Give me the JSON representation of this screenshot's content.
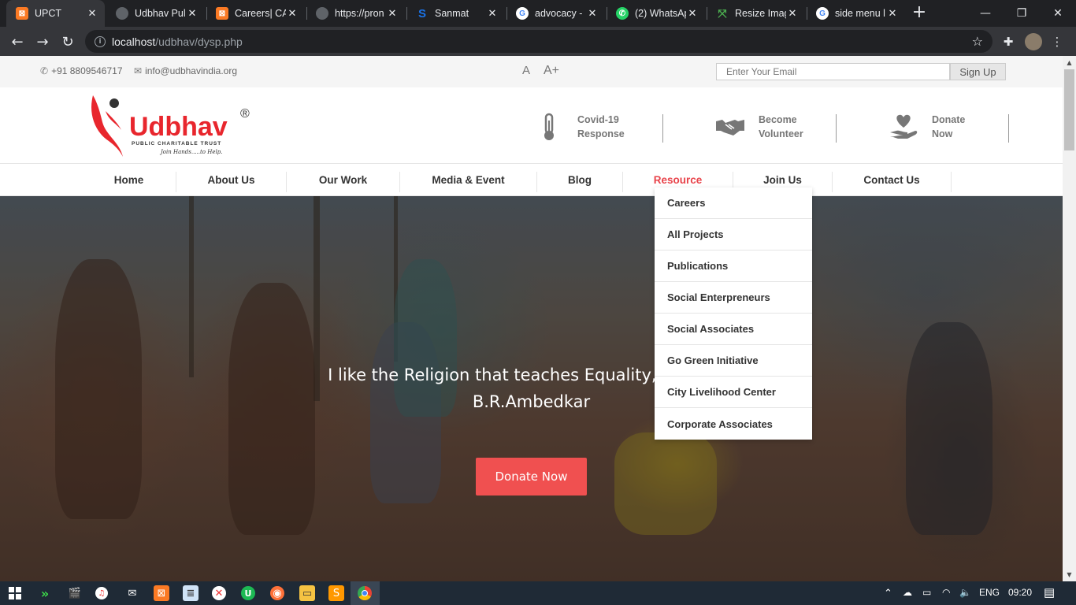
{
  "browser": {
    "tabs": [
      {
        "title": "UPCT",
        "favicon": "xampp-icon",
        "color": "#fb7a24"
      },
      {
        "title": "Udbhav Pul",
        "favicon": "globe-icon",
        "color": "#5f6368"
      },
      {
        "title": "Careers| CA",
        "favicon": "xampp-icon",
        "color": "#fb7a24"
      },
      {
        "title": "https://pron",
        "favicon": "globe-icon",
        "color": "#5f6368"
      },
      {
        "title": "Sanmat",
        "favicon": "s-icon",
        "color": "#1a73e8"
      },
      {
        "title": "advocacy -",
        "favicon": "google-icon",
        "color": "#ffffff"
      },
      {
        "title": "(2) WhatsAp",
        "favicon": "whatsapp-icon",
        "color": "#25d366"
      },
      {
        "title": "Resize Imag",
        "favicon": "resize-icon",
        "color": "#2e7d32"
      },
      {
        "title": "side menu l",
        "favicon": "google-icon",
        "color": "#ffffff"
      }
    ],
    "url_host": "localhost",
    "url_path": "/udbhav/dysp.php"
  },
  "topbar": {
    "phone": "+91 8809546717",
    "email": "info@udbhavindia.org",
    "font_small": "A",
    "font_large": "A+",
    "email_placeholder": "Enter Your Email",
    "signup_label": "Sign Up"
  },
  "logo": {
    "name": "Udbhav",
    "registered": "®",
    "tagline": "PUBLIC CHARITABLE TRUST",
    "slogan": "Join Hands.....to Help.",
    "brand_color": "#e8262d"
  },
  "header_items": [
    {
      "line1": "Covid-19",
      "line2": "Response",
      "icon": "thermometer-icon"
    },
    {
      "line1": "Become",
      "line2": "Volunteer",
      "icon": "handshake-icon"
    },
    {
      "line1": "Donate",
      "line2": "Now",
      "icon": "heart-hand-icon"
    }
  ],
  "nav": [
    {
      "label": "Home"
    },
    {
      "label": "About Us"
    },
    {
      "label": "Our Work"
    },
    {
      "label": "Media & Event"
    },
    {
      "label": "Blog"
    },
    {
      "label": "Resource",
      "active": true
    },
    {
      "label": "Join Us"
    },
    {
      "label": "Contact Us"
    }
  ],
  "dropdown": [
    "Careers",
    "All Projects",
    "Publications",
    "Social Enterpreneurs",
    "Social Associates",
    "Go Green Initiative",
    "City Livelihood Center",
    "Corporate Associates"
  ],
  "hero": {
    "quote_line1": "I like the Religion that teaches Equality, Liberty a",
    "quote_line2": "B.R.Ambedkar",
    "cta_label": "Donate Now",
    "cta_color": "#f05050"
  },
  "taskbar": {
    "language": "ENG",
    "time": "09:20"
  }
}
